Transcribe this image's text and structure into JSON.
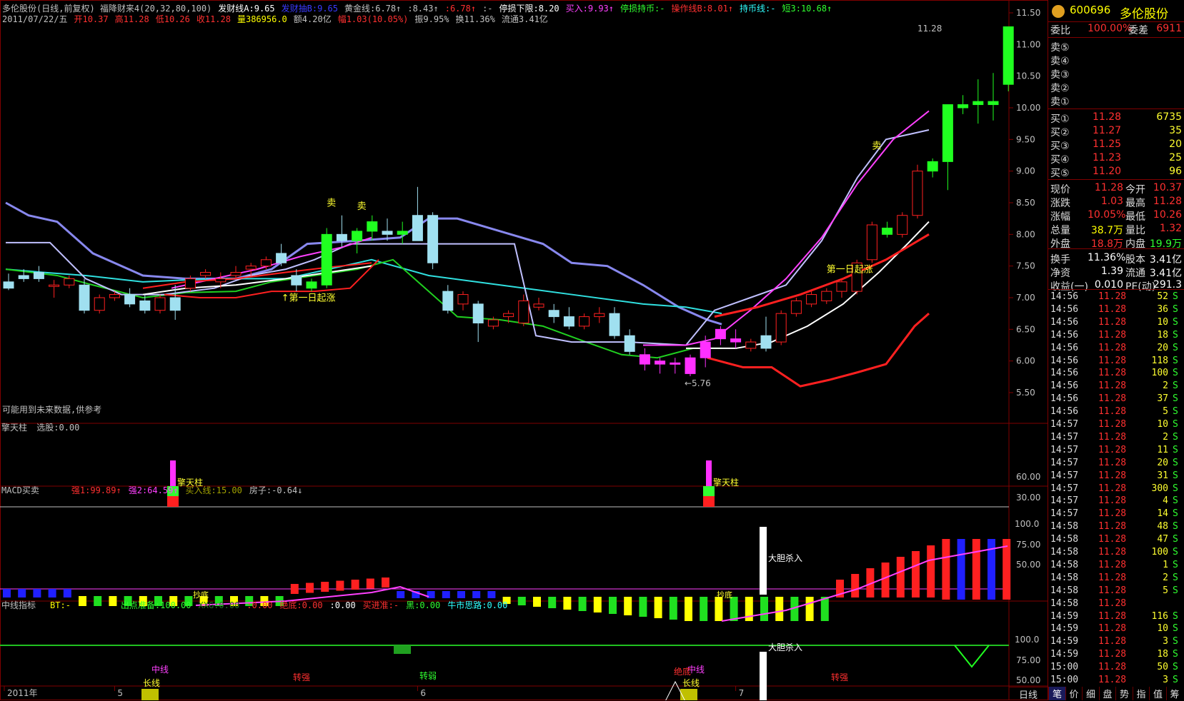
{
  "header": {
    "line1": [
      {
        "text": "多伦股份(日线,前复权) 福降财来4(20,32,80,100)",
        "color": "#c0c0c0"
      },
      {
        "text": "发财线A:9.65",
        "color": "#ffffff"
      },
      {
        "text": "发财抽B:9.65",
        "color": "#3a3aff"
      },
      {
        "text": "黄金线:6.78↑",
        "color": "#c0c0c0"
      },
      {
        "text": ":8.43↑",
        "color": "#c0c0c0"
      },
      {
        "text": ":6.78↑",
        "color": "#ff3030"
      },
      {
        "text": ":-",
        "color": "#c0c0c0"
      },
      {
        "text": "停损下限:8.20",
        "color": "#ffffff"
      },
      {
        "text": "买入:9.93↑",
        "color": "#ff40ff"
      },
      {
        "text": "停损持币:-",
        "color": "#30ff30"
      },
      {
        "text": "操作线B:8.01↑",
        "color": "#ff3030"
      },
      {
        "text": "持币线:-",
        "color": "#30ffff"
      },
      {
        "text": "短3:10.68↑",
        "color": "#30ff30"
      }
    ],
    "line2": [
      {
        "text": "2011/07/22/五",
        "color": "#c0c0c0"
      },
      {
        "text": "开10.37",
        "color": "#ff3030"
      },
      {
        "text": "高11.28",
        "color": "#ff3030"
      },
      {
        "text": "低10.26",
        "color": "#ff3030"
      },
      {
        "text": "收11.28",
        "color": "#ff3030"
      },
      {
        "text": "量386956.0",
        "color": "#ffff00"
      },
      {
        "text": "额4.20亿",
        "color": "#c0c0c0"
      },
      {
        "text": "幅1.03(10.05%)",
        "color": "#ff3030"
      },
      {
        "text": "振9.95%",
        "color": "#c0c0c0"
      },
      {
        "text": "换11.36%",
        "color": "#c0c0c0"
      },
      {
        "text": "流通3.41亿",
        "color": "#c0c0c0"
      }
    ],
    "note": "可能用到未来数据,供参考"
  },
  "chart_data": {
    "type": "candlestick",
    "title": "多伦股份(日线,前复权)",
    "price_axis": [
      11.5,
      11.0,
      10.5,
      10.0,
      9.5,
      9.0,
      8.5,
      8.0,
      7.5,
      7.0,
      6.5,
      6.0,
      5.5
    ],
    "x_labels": [
      {
        "label": "2011年",
        "index": 0
      },
      {
        "label": "5",
        "index": 7
      },
      {
        "label": "6",
        "index": 27
      },
      {
        "label": "7",
        "index": 48
      }
    ],
    "candles": [
      {
        "o": 7.25,
        "h": 7.38,
        "l": 7.12,
        "c": 7.15
      },
      {
        "o": 7.35,
        "h": 7.45,
        "l": 7.25,
        "c": 7.3
      },
      {
        "o": 7.4,
        "h": 7.5,
        "l": 7.25,
        "c": 7.3
      },
      {
        "o": 7.2,
        "h": 7.28,
        "l": 7.0,
        "c": 7.2
      },
      {
        "o": 7.2,
        "h": 7.35,
        "l": 7.15,
        "c": 7.3
      },
      {
        "o": 7.2,
        "h": 7.3,
        "l": 6.75,
        "c": 6.8
      },
      {
        "o": 6.8,
        "h": 7.05,
        "l": 6.75,
        "c": 7.0
      },
      {
        "o": 7.0,
        "h": 7.1,
        "l": 6.95,
        "c": 7.05
      },
      {
        "o": 7.05,
        "h": 7.15,
        "l": 6.85,
        "c": 6.9
      },
      {
        "o": 6.95,
        "h": 7.05,
        "l": 6.75,
        "c": 6.8
      },
      {
        "o": 6.8,
        "h": 7.05,
        "l": 6.75,
        "c": 7.0
      },
      {
        "o": 7.0,
        "h": 7.2,
        "l": 6.65,
        "c": 6.8
      },
      {
        "o": 7.15,
        "h": 7.35,
        "l": 7.1,
        "c": 7.3
      },
      {
        "o": 7.35,
        "h": 7.45,
        "l": 7.3,
        "c": 7.4
      },
      {
        "o": 7.25,
        "h": 7.4,
        "l": 7.15,
        "c": 7.3
      },
      {
        "o": 7.35,
        "h": 7.5,
        "l": 7.3,
        "c": 7.4
      },
      {
        "o": 7.45,
        "h": 7.55,
        "l": 7.35,
        "c": 7.5
      },
      {
        "o": 7.5,
        "h": 7.65,
        "l": 7.45,
        "c": 7.6
      },
      {
        "o": 7.7,
        "h": 7.85,
        "l": 7.5,
        "c": 7.55
      },
      {
        "o": 7.35,
        "h": 7.45,
        "l": 7.1,
        "c": 7.2
      },
      {
        "o": 7.15,
        "h": 7.3,
        "l": 7.1,
        "c": 7.25
      },
      {
        "o": 7.2,
        "h": 8.1,
        "l": 7.15,
        "c": 8.0
      },
      {
        "o": 8.0,
        "h": 8.3,
        "l": 7.8,
        "c": 7.9
      },
      {
        "o": 7.9,
        "h": 8.1,
        "l": 7.7,
        "c": 8.05
      },
      {
        "o": 8.05,
        "h": 8.3,
        "l": 7.9,
        "c": 8.2
      },
      {
        "o": 8.05,
        "h": 8.25,
        "l": 7.9,
        "c": 8.0
      },
      {
        "o": 8.0,
        "h": 8.2,
        "l": 7.85,
        "c": 8.05
      },
      {
        "o": 8.3,
        "h": 8.75,
        "l": 7.95,
        "c": 7.9
      },
      {
        "o": 8.3,
        "h": 8.35,
        "l": 7.45,
        "c": 7.55
      },
      {
        "o": 7.1,
        "h": 7.2,
        "l": 6.75,
        "c": 6.8
      },
      {
        "o": 6.9,
        "h": 7.1,
        "l": 6.8,
        "c": 7.05
      },
      {
        "o": 6.9,
        "h": 6.95,
        "l": 6.3,
        "c": 6.6
      },
      {
        "o": 6.55,
        "h": 6.7,
        "l": 6.5,
        "c": 6.65
      },
      {
        "o": 6.7,
        "h": 6.8,
        "l": 6.6,
        "c": 6.75
      },
      {
        "o": 6.6,
        "h": 7.05,
        "l": 6.55,
        "c": 6.95
      },
      {
        "o": 6.85,
        "h": 7.0,
        "l": 6.8,
        "c": 6.9
      },
      {
        "o": 6.8,
        "h": 6.9,
        "l": 6.6,
        "c": 6.7
      },
      {
        "o": 6.7,
        "h": 6.85,
        "l": 6.5,
        "c": 6.55
      },
      {
        "o": 6.55,
        "h": 6.75,
        "l": 6.5,
        "c": 6.7
      },
      {
        "o": 6.7,
        "h": 6.85,
        "l": 6.6,
        "c": 6.75
      },
      {
        "o": 6.75,
        "h": 6.85,
        "l": 6.35,
        "c": 6.4
      },
      {
        "o": 6.4,
        "h": 6.5,
        "l": 6.1,
        "c": 6.15
      },
      {
        "o": 6.1,
        "h": 6.2,
        "l": 5.85,
        "c": 5.95
      },
      {
        "o": 5.95,
        "h": 6.05,
        "l": 5.8,
        "c": 6.0
      },
      {
        "o": 5.95,
        "h": 6.05,
        "l": 5.8,
        "c": 5.97
      },
      {
        "o": 5.8,
        "h": 6.1,
        "l": 5.76,
        "c": 6.05
      },
      {
        "o": 6.05,
        "h": 6.4,
        "l": 5.9,
        "c": 6.3
      },
      {
        "o": 6.35,
        "h": 6.55,
        "l": 6.25,
        "c": 6.5
      },
      {
        "o": 6.35,
        "h": 6.5,
        "l": 6.2,
        "c": 6.3
      },
      {
        "o": 6.2,
        "h": 6.35,
        "l": 6.15,
        "c": 6.3
      },
      {
        "o": 6.4,
        "h": 6.7,
        "l": 6.15,
        "c": 6.2
      },
      {
        "o": 6.3,
        "h": 6.8,
        "l": 6.25,
        "c": 6.75
      },
      {
        "o": 6.75,
        "h": 7.0,
        "l": 6.7,
        "c": 6.95
      },
      {
        "o": 6.9,
        "h": 7.1,
        "l": 6.85,
        "c": 7.05
      },
      {
        "o": 6.95,
        "h": 7.15,
        "l": 6.9,
        "c": 7.1
      },
      {
        "o": 7.1,
        "h": 7.3,
        "l": 7.0,
        "c": 7.25
      },
      {
        "o": 7.1,
        "h": 7.6,
        "l": 7.05,
        "c": 7.55
      },
      {
        "o": 7.6,
        "h": 8.2,
        "l": 7.55,
        "c": 8.15
      },
      {
        "o": 8.1,
        "h": 8.2,
        "l": 7.95,
        "c": 8.0
      },
      {
        "o": 8.0,
        "h": 8.35,
        "l": 7.95,
        "c": 8.3
      },
      {
        "o": 8.3,
        "h": 9.1,
        "l": 8.25,
        "c": 9.0
      },
      {
        "o": 9.0,
        "h": 9.2,
        "l": 8.9,
        "c": 9.15
      },
      {
        "o": 9.15,
        "h": 9.2,
        "l": 8.7,
        "c": 10.05
      },
      {
        "o": 10.05,
        "h": 10.2,
        "l": 9.9,
        "c": 10.0
      },
      {
        "o": 10.1,
        "h": 10.45,
        "l": 9.75,
        "c": 10.05
      },
      {
        "o": 10.1,
        "h": 10.55,
        "l": 9.8,
        "c": 10.05
      },
      {
        "o": 10.37,
        "h": 11.28,
        "l": 10.26,
        "c": 11.28
      }
    ],
    "last_price_label": "11.28",
    "low_label": "←5.76",
    "annotations": [
      {
        "text": "卖",
        "index": 21,
        "price": 8.45
      },
      {
        "text": "卖",
        "index": 23,
        "price": 8.4
      },
      {
        "text": "↑第一日起涨",
        "index": 18,
        "price": 6.95
      },
      {
        "text": "第一日起涨",
        "index": 54,
        "price": 7.4
      },
      {
        "text": "卖",
        "index": 57,
        "price": 9.35
      }
    ]
  },
  "sub1": {
    "title": "擎天柱",
    "sel": "选股:0.00",
    "label": "擎天柱",
    "axis": [
      "60.00",
      "30.00"
    ]
  },
  "sub2": {
    "title": "MACD买卖",
    "items": [
      {
        "text": "强1:99.89↑",
        "color": "#ff3030"
      },
      {
        "text": "强2:64.59↑",
        "color": "#ff40ff"
      },
      {
        "text": "买入线:15.00",
        "color": "#a0a000"
      },
      {
        "text": "房子:-0.64↓",
        "color": "#c0c0c0"
      }
    ],
    "axis": [
      "100.0",
      "75.00",
      "50.00"
    ],
    "buy_label": "大胆杀入",
    "bottom_label": "抄底"
  },
  "sub3": {
    "title": "中线指标",
    "items": [
      {
        "text": "BT:-",
        "color": "#ffff00"
      },
      {
        "text": "出点准备:100.00",
        "color": "#30ff30"
      },
      {
        "text": "XXG:0.00",
        "color": "#207020"
      },
      {
        "text": ":0.00",
        "color": "#ff3030"
      },
      {
        "text": "绝底:0.00",
        "color": "#ff3030"
      },
      {
        "text": ":0.00",
        "color": "#ffffff"
      },
      {
        "text": "买进准:-",
        "color": "#ff3030"
      },
      {
        "text": "黑:0.00",
        "color": "#30ff30"
      },
      {
        "text": "牛市思路:0.00",
        "color": "#30ffff"
      }
    ],
    "axis": [
      "100.0",
      "75.00",
      "50.00"
    ],
    "labels": {
      "zhongxian": "中线",
      "changxian": "长线",
      "zhuanqiang": "转强",
      "zhuanruo": "转弱",
      "juedi": "绝底",
      "buy": "大胆杀入"
    }
  },
  "quote": {
    "code": "600696",
    "name": "多伦股份",
    "weibi_label": "委比",
    "weibi": "100.00%",
    "weicha_label": "委差",
    "weicha": "6911",
    "sells": [
      "卖⑤",
      "卖④",
      "卖③",
      "卖②",
      "卖①"
    ],
    "buys": [
      {
        "label": "买①",
        "price": "11.28",
        "vol": "6735"
      },
      {
        "label": "买②",
        "price": "11.27",
        "vol": "35"
      },
      {
        "label": "买③",
        "price": "11.25",
        "vol": "20"
      },
      {
        "label": "买④",
        "price": "11.23",
        "vol": "25"
      },
      {
        "label": "买⑤",
        "price": "11.20",
        "vol": "96"
      }
    ],
    "stats": [
      {
        "l1": "现价",
        "v1": "11.28",
        "c1": "#ff3030",
        "l2": "今开",
        "v2": "10.37",
        "c2": "#ff3030"
      },
      {
        "l1": "涨跌",
        "v1": "1.03",
        "c1": "#ff3030",
        "l2": "最高",
        "v2": "11.28",
        "c2": "#ff3030"
      },
      {
        "l1": "涨幅",
        "v1": "10.05%",
        "c1": "#ff3030",
        "l2": "最低",
        "v2": "10.26",
        "c2": "#ff3030"
      },
      {
        "l1": "总量",
        "v1": "38.7万",
        "c1": "#ffff00",
        "l2": "量比",
        "v2": "1.32",
        "c2": "#ff3030"
      },
      {
        "l1": "外盘",
        "v1": "18.8万",
        "c1": "#ff3030",
        "l2": "内盘",
        "v2": "19.9万",
        "c2": "#30ff30"
      },
      {
        "l1": "换手",
        "v1": "11.36%",
        "c1": "#ffffff",
        "l2": "股本",
        "v2": "3.41亿",
        "c2": "#ffffff"
      },
      {
        "l1": "净资",
        "v1": "1.39",
        "c1": "#ffffff",
        "l2": "流通",
        "v2": "3.41亿",
        "c2": "#ffffff"
      },
      {
        "l1": "收益(一)",
        "v1": "0.010",
        "c1": "#ffffff",
        "l2": "PE(动)",
        "v2": "291.3",
        "c2": "#ffffff"
      }
    ],
    "ticks": [
      [
        "14:56",
        "11.28",
        "52",
        "S"
      ],
      [
        "14:56",
        "11.28",
        "36",
        "S"
      ],
      [
        "14:56",
        "11.28",
        "10",
        "S"
      ],
      [
        "14:56",
        "11.28",
        "18",
        "S"
      ],
      [
        "14:56",
        "11.28",
        "20",
        "S"
      ],
      [
        "14:56",
        "11.28",
        "118",
        "S"
      ],
      [
        "14:56",
        "11.28",
        "100",
        "S"
      ],
      [
        "14:56",
        "11.28",
        "2",
        "S"
      ],
      [
        "14:56",
        "11.28",
        "37",
        "S"
      ],
      [
        "14:56",
        "11.28",
        "5",
        "S"
      ],
      [
        "14:57",
        "11.28",
        "10",
        "S"
      ],
      [
        "14:57",
        "11.28",
        "2",
        "S"
      ],
      [
        "14:57",
        "11.28",
        "11",
        "S"
      ],
      [
        "14:57",
        "11.28",
        "20",
        "S"
      ],
      [
        "14:57",
        "11.28",
        "31",
        "S"
      ],
      [
        "14:57",
        "11.28",
        "300",
        "S"
      ],
      [
        "14:57",
        "11.28",
        "4",
        "S"
      ],
      [
        "14:57",
        "11.28",
        "14",
        "S"
      ],
      [
        "14:58",
        "11.28",
        "48",
        "S"
      ],
      [
        "14:58",
        "11.28",
        "47",
        "S"
      ],
      [
        "14:58",
        "11.28",
        "100",
        "S"
      ],
      [
        "14:58",
        "11.28",
        "1",
        "S"
      ],
      [
        "14:58",
        "11.28",
        "2",
        "S"
      ],
      [
        "14:58",
        "11.28",
        "5",
        "S"
      ],
      [
        "14:58",
        "11.28",
        "",
        ""
      ],
      [
        "14:59",
        "11.28",
        "116",
        "S"
      ],
      [
        "14:59",
        "11.28",
        "10",
        "S"
      ],
      [
        "14:59",
        "11.28",
        "3",
        "S"
      ],
      [
        "14:59",
        "11.28",
        "18",
        "S"
      ],
      [
        "15:00",
        "11.28",
        "50",
        "S"
      ],
      [
        "15:00",
        "11.28",
        "3",
        "S"
      ]
    ],
    "tabs": [
      "笔",
      "价",
      "细",
      "盘",
      "势",
      "指",
      "值",
      "筹"
    ]
  },
  "period_tab": "日线"
}
